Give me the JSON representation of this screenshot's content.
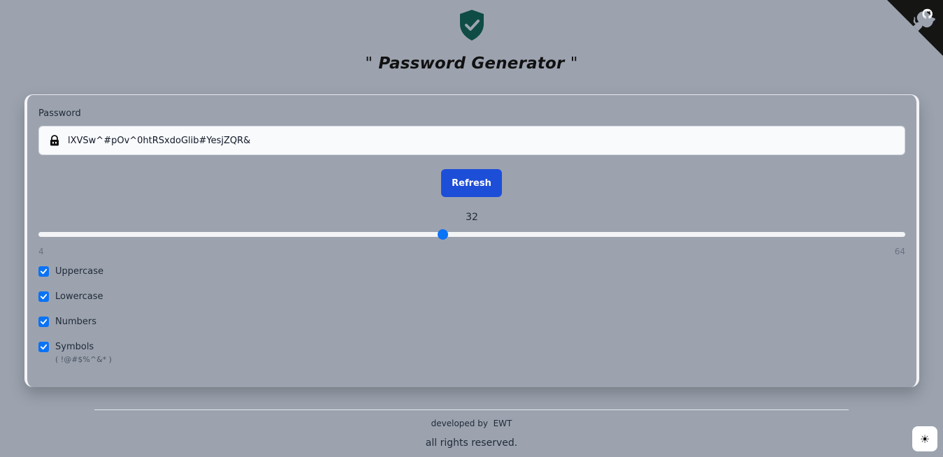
{
  "header": {
    "title": "Password Generator",
    "quote_open": "\"",
    "quote_close": "\"",
    "shield_icon": "shield-check-icon",
    "shield_color": "#0f4c45"
  },
  "form": {
    "password_label": "Password",
    "password_value": "lXVSw^#pOv^0htRSxdoGlib#YesjZQR&",
    "refresh_label": "Refresh",
    "length": {
      "value": "32",
      "min": "4",
      "max": "64"
    },
    "options": [
      {
        "label": "Uppercase",
        "checked": true
      },
      {
        "label": "Lowercase",
        "checked": true
      },
      {
        "label": "Numbers",
        "checked": true
      },
      {
        "label": "Symbols",
        "checked": true
      }
    ],
    "symbols_hint": "( !@#$%^&* )"
  },
  "footer": {
    "developed_by": "developed by",
    "developer": "EWT",
    "rights": "all rights reserved."
  },
  "theme_toggle_icon": "sun-icon",
  "colors": {
    "background": "#9ca3af",
    "accent": "#1d4ed8",
    "checkbox": "#0b73f5"
  }
}
